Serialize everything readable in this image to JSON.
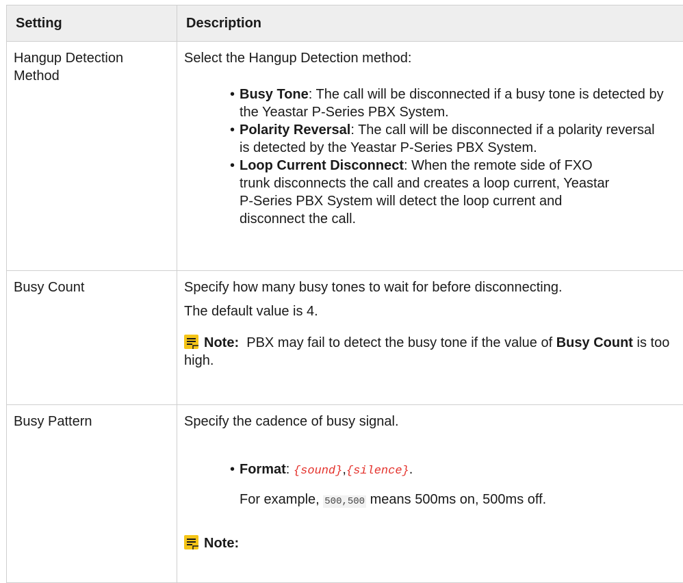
{
  "header": {
    "setting": "Setting",
    "description": "Description"
  },
  "row1": {
    "setting": "Hangup Detection Method",
    "intro": "Select the Hangup Detection method:",
    "items": [
      {
        "bold": "Busy Tone",
        "text": ": The call will be disconnected if a busy tone is detected by the Yeastar P-Series PBX System."
      },
      {
        "bold": "Polarity Reversal",
        "text": ": The call will be disconnected if a polarity reversal is detected by the Yeastar P-Series PBX System."
      },
      {
        "bold": "Loop Current Disconnect",
        "text": ": When the remote side of FXO trunk disconnects the call and creates a loop current, Yeastar P-Series PBX System will detect the loop current and disconnect the call."
      }
    ]
  },
  "row2": {
    "setting": "Busy Count",
    "line1": "Specify how many busy tones to wait for before disconnecting.",
    "line2": "The default value is 4.",
    "note_label": "Note:",
    "note_text1": "PBX may fail to detect the busy tone if the value of",
    "note_bold": "Busy Count",
    "note_text2": "is too high."
  },
  "row3": {
    "setting": "Busy Pattern",
    "intro": "Specify the cadence of busy signal.",
    "format_label": "Format",
    "format_colon": ": ",
    "format_sound": "{sound}",
    "format_comma": ",",
    "format_silence": "{silence}",
    "format_end": ".",
    "example_pre": "For example, ",
    "example_code": "500,500",
    "example_post": " means 500ms on, 500ms off.",
    "note_label": "Note:"
  },
  "colors": {
    "accent_red": "#e4312b",
    "note_yellow": "#f5c518",
    "header_bg": "#eeeeee"
  },
  "icons": [
    "note-icon"
  ]
}
